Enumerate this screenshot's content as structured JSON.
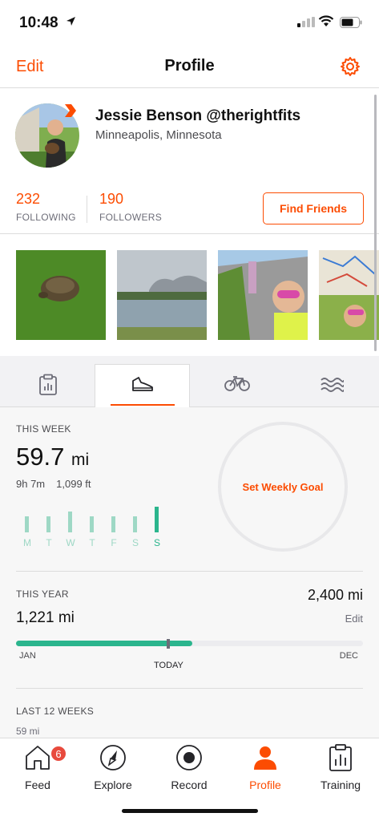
{
  "status_bar": {
    "time": "10:48"
  },
  "nav": {
    "edit_label": "Edit",
    "title": "Profile"
  },
  "profile": {
    "name": "Jessie Benson @therightfits",
    "location": "Minneapolis, Minnesota",
    "following_count": "232",
    "following_label": "FOLLOWING",
    "followers_count": "190",
    "followers_label": "FOLLOWERS",
    "find_friends_label": "Find Friends"
  },
  "stats": {
    "this_week_label": "THIS WEEK",
    "week_distance": "59.7",
    "week_unit": "mi",
    "week_time": "9h 7m",
    "week_elev": "1,099 ft",
    "days": [
      "M",
      "T",
      "W",
      "T",
      "F",
      "S",
      "S"
    ],
    "day_bar_levels": [
      0.6,
      0.6,
      0.75,
      0.6,
      0.6,
      0.6,
      0.95
    ],
    "today_index": 6,
    "goal_label": "Set Weekly Goal",
    "this_year_label": "THIS YEAR",
    "year_goal": "2,400 mi",
    "year_distance": "1,221 mi",
    "year_edit": "Edit",
    "year_progress": 0.509,
    "jan_label": "JAN",
    "dec_label": "DEC",
    "today_label": "TODAY",
    "last12_label": "LAST 12 WEEKS",
    "last12_value": "59 mi"
  },
  "tabbar": {
    "items": [
      {
        "label": "Feed",
        "badge": "6"
      },
      {
        "label": "Explore"
      },
      {
        "label": "Record"
      },
      {
        "label": "Profile"
      },
      {
        "label": "Training"
      }
    ],
    "active_index": 3
  },
  "colors": {
    "accent": "#fc4c02",
    "green": "#2bb58d",
    "light_green": "#9ed8c5"
  }
}
